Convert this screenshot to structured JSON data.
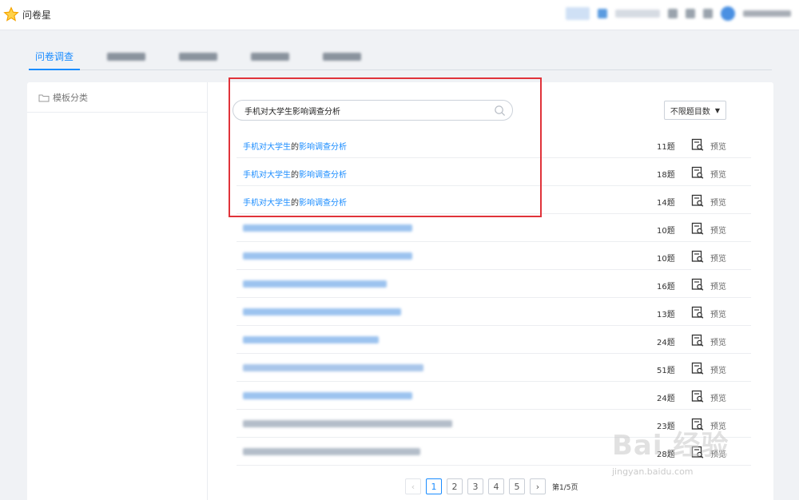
{
  "header": {
    "logo_text": "问卷星"
  },
  "tabs": {
    "active_label": "问卷调查"
  },
  "sidebar": {
    "heading": "模板分类"
  },
  "search": {
    "query": "手机对大学生影响调查分析"
  },
  "filter": {
    "label": "不限题目数"
  },
  "results": [
    {
      "title_prefix": "手机对大学生",
      "title_mid": "的",
      "title_suffix": "影响调查分析",
      "count": "11题",
      "preview": "预览"
    },
    {
      "title_prefix": "手机对大学生",
      "title_mid": "的",
      "title_suffix": "影响调查分析",
      "count": "18题",
      "preview": "预览"
    },
    {
      "title_prefix": "手机对大学生",
      "title_mid": "的",
      "title_suffix": "影响调查分析",
      "count": "14题",
      "preview": "预览"
    },
    {
      "count": "10题",
      "preview": "预览"
    },
    {
      "count": "10题",
      "preview": "预览"
    },
    {
      "count": "16题",
      "preview": "预览"
    },
    {
      "count": "13题",
      "preview": "预览"
    },
    {
      "count": "24题",
      "preview": "预览"
    },
    {
      "count": "51题",
      "preview": "预览"
    },
    {
      "count": "24题",
      "preview": "预览"
    },
    {
      "count": "23题",
      "preview": "预览"
    },
    {
      "count": "28题",
      "preview": "预览"
    }
  ],
  "pagination": {
    "pages": [
      "1",
      "2",
      "3",
      "4",
      "5"
    ],
    "info": "第1/5页",
    "prev": "‹",
    "next": "›"
  },
  "watermark": {
    "brand": "Bai 经验",
    "url": "jingyan.baidu.com"
  },
  "colors": {
    "accent": "#1a8cff",
    "highlight_border": "#e0333a"
  }
}
